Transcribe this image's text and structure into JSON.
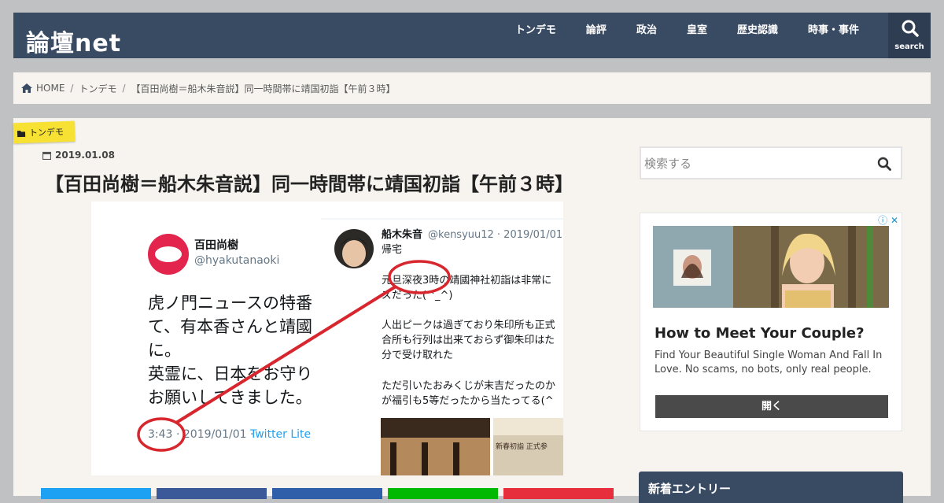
{
  "site": {
    "logo": "論壇net"
  },
  "nav": {
    "items": [
      "トンデモ",
      "論評",
      "政治",
      "皇室",
      "歴史認識",
      "時事・事件"
    ],
    "search_label": "search"
  },
  "breadcrumb": {
    "home": "HOME",
    "category": "トンデモ",
    "current": "【百田尚樹＝船木朱音説】同一時間帯に靖国初詣【午前３時】"
  },
  "post": {
    "category": "トンデモ",
    "date": "2019.01.08",
    "title": "【百田尚樹＝船木朱音説】同一時間帯に靖国初詣【午前３時】"
  },
  "eyecatch": {
    "left_tweet": {
      "name": "百田尚樹",
      "handle": "@hyakutanaoki",
      "lines": [
        "虎ノ門ニュースの特番",
        "て、有本香さんと靖國",
        "に。",
        "英霊に、日本をお守り",
        "お願いしてきました。"
      ],
      "time": "3:43",
      "date": "· 2019/01/01 ·",
      "client": "Twitter Lite"
    },
    "right_tweet": {
      "name": "船木朱音",
      "handle": "@kensyuu12 · 2019/01/01",
      "lines": [
        "帰宅",
        "",
        "元旦深夜3時の靖國神社初詣は非常に",
        "ズだった(^_^)",
        "",
        "人出ピークは過ぎており朱印所も正式",
        "合所も行列は出来ておらず御朱印はた",
        "分で受け取れた",
        "",
        "ただ引いたおみくじが末吉だったのか",
        "が福引も5等だったから当たってる(^"
      ],
      "photo_text": "新春初詣 正式参"
    },
    "annotation_color": "#d8262e"
  },
  "sidebar": {
    "search_placeholder": "検索する",
    "ad": {
      "title": "How to Meet Your Couple?",
      "text": "Find Your Beautiful Single Woman And Fall In Love. No scams, no bots, only real people.",
      "button": "開く"
    },
    "new_entries_title": "新着エントリー"
  },
  "share_colors": [
    "#1da1f2",
    "#3b5998",
    "#2f5fa8",
    "#00b900",
    "#e62e3d"
  ],
  "colors": {
    "header_bg": "#394a63",
    "tag_bg": "#f7e234",
    "page_bg": "#bfc1c2"
  }
}
